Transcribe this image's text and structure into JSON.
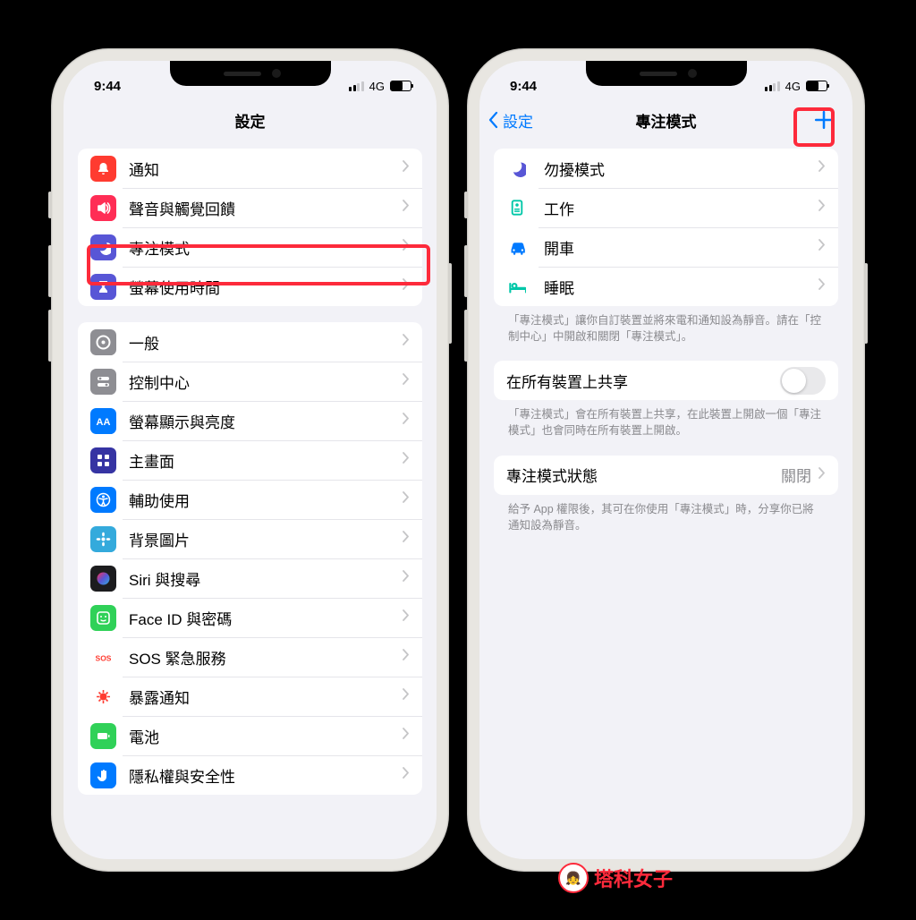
{
  "status": {
    "time": "9:44",
    "carrier": "4G"
  },
  "left": {
    "title": "設定",
    "group1": [
      {
        "icon": "bell",
        "color": "#ff3b30",
        "label": "通知"
      },
      {
        "icon": "sound",
        "color": "#ff2d55",
        "label": "聲音與觸覺回饋"
      },
      {
        "icon": "moon",
        "color": "#5856d6",
        "label": "專注模式"
      },
      {
        "icon": "hourglass",
        "color": "#5856d6",
        "label": "螢幕使用時間"
      }
    ],
    "group2": [
      {
        "icon": "gear",
        "color": "#8e8e93",
        "label": "一般"
      },
      {
        "icon": "switches",
        "color": "#8e8e93",
        "label": "控制中心"
      },
      {
        "icon": "aa",
        "color": "#007aff",
        "label": "螢幕顯示與亮度"
      },
      {
        "icon": "grid",
        "color": "#3634a3",
        "label": "主畫面"
      },
      {
        "icon": "accessibility",
        "color": "#007aff",
        "label": "輔助使用"
      },
      {
        "icon": "flower",
        "color": "#34aadc",
        "label": "背景圖片"
      },
      {
        "icon": "siri",
        "color": "#1c1c1e",
        "label": "Siri 與搜尋"
      },
      {
        "icon": "faceid",
        "color": "#30d158",
        "label": "Face ID 與密碼"
      },
      {
        "icon": "sos",
        "color": "#ffffff",
        "labelcolor": "#ff3b30",
        "label": "SOS 緊急服務"
      },
      {
        "icon": "virus",
        "color": "#ffffff",
        "labelcolor": "#ff3b30",
        "label": "暴露通知"
      },
      {
        "icon": "battery",
        "color": "#30d158",
        "label": "電池"
      },
      {
        "icon": "hand",
        "color": "#007aff",
        "label": "隱私權與安全性"
      }
    ]
  },
  "right": {
    "back": "設定",
    "title": "專注模式",
    "modes": [
      {
        "icon": "moon",
        "color": "#5856d6",
        "label": "勿擾模式"
      },
      {
        "icon": "badge",
        "color": "#00c7a8",
        "label": "工作"
      },
      {
        "icon": "car",
        "color": "#007aff",
        "label": "開車"
      },
      {
        "icon": "bed",
        "color": "#00c7a8",
        "label": "睡眠"
      }
    ],
    "modes_footer": "「專注模式」讓你自訂裝置並將來電和通知設為靜音。請在「控制中心」中開啟和關閉「專注模式」。",
    "share_label": "在所有裝置上共享",
    "share_footer": "「專注模式」會在所有裝置上共享，在此裝置上開啟一個「專注模式」也會同時在所有裝置上開啟。",
    "status_label": "專注模式狀態",
    "status_value": "關閉",
    "status_footer": "給予 App 權限後，其可在你使用「專注模式」時，分享你已將通知設為靜音。"
  },
  "watermark": "塔科女子"
}
